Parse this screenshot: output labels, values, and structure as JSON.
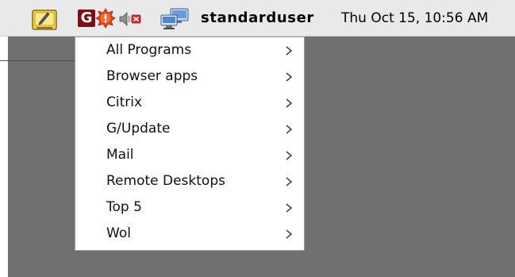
{
  "panel": {
    "username": "standarduser",
    "datetime": "Thu Oct 15, 10:56 AM",
    "tray_icons": [
      {
        "name": "notes-icon"
      },
      {
        "name": "g-app-icon",
        "label": "G"
      },
      {
        "name": "alert-icon"
      },
      {
        "name": "volume-muted-icon"
      },
      {
        "name": "network-icon"
      }
    ]
  },
  "menu": {
    "items": [
      {
        "label": "All Programs",
        "has_submenu": true
      },
      {
        "label": "Browser apps",
        "has_submenu": true
      },
      {
        "label": "Citrix",
        "has_submenu": true
      },
      {
        "label": "G/Update",
        "has_submenu": true
      },
      {
        "label": "Mail",
        "has_submenu": true
      },
      {
        "label": "Remote Desktops",
        "has_submenu": true
      },
      {
        "label": "Top 5",
        "has_submenu": true
      },
      {
        "label": "Wol",
        "has_submenu": true
      }
    ]
  },
  "colors": {
    "panel_bg": "#e9e9e9",
    "desktop_bg": "#707070",
    "menu_bg": "#ffffff",
    "g_icon_bg": "#7a0f15",
    "alert_icon": "#e8431c"
  }
}
